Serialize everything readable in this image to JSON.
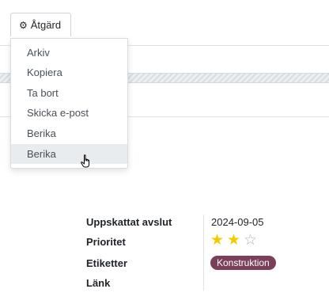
{
  "action_button": {
    "icon": "gear-icon",
    "label": "Åtgärd"
  },
  "menu": {
    "items": [
      {
        "label": "Arkiv"
      },
      {
        "label": "Kopiera"
      },
      {
        "label": "Ta bort"
      },
      {
        "label": "Skicka e-post"
      },
      {
        "label": "Berika"
      },
      {
        "label": "Berika"
      }
    ],
    "highlighted_index": 5
  },
  "fields": {
    "deadline": {
      "label": "Uppskattat avslut",
      "value": "2024-09-05"
    },
    "priority": {
      "label": "Prioritet",
      "stars_filled": 2,
      "stars_total": 3,
      "star_color": "#f3cc00"
    },
    "tags": {
      "label": "Etiketter",
      "items": [
        {
          "label": "Konstruktion",
          "color": "#7b3f5a"
        }
      ]
    },
    "link": {
      "label": "Länk"
    }
  }
}
